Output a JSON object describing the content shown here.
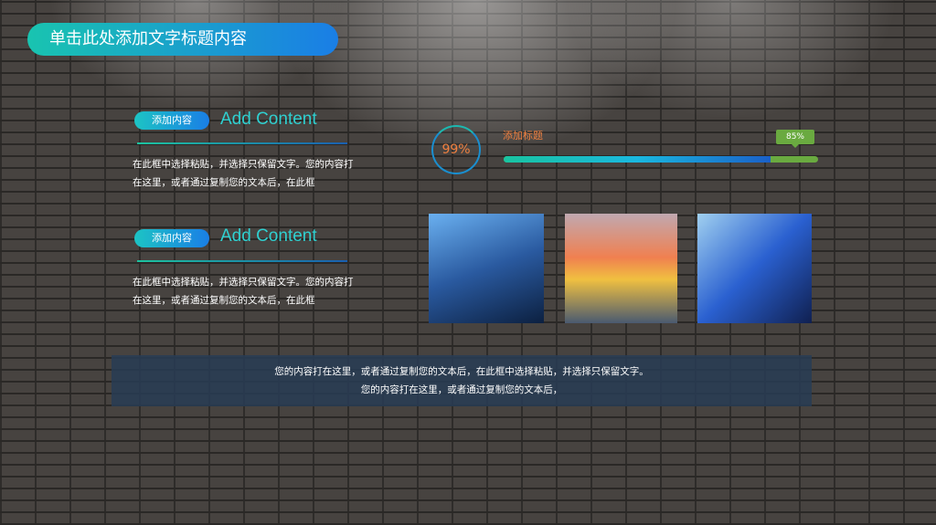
{
  "title": "单击此处添加文字标题内容",
  "sections": [
    {
      "pill": "添加内容",
      "heading": "Add Content",
      "text": "在此框中选择粘贴，并选择只保留文字。您的内容打在这里，或者通过复制您的文本后，在此框"
    },
    {
      "pill": "添加内容",
      "heading": "Add Content",
      "text": "在此框中选择粘贴，并选择只保留文字。您的内容打在这里，或者通过复制您的文本后，在此框"
    }
  ],
  "ring_label": "99%",
  "progress": {
    "label": "添加标题",
    "value_label": "85%",
    "value": 85
  },
  "note": {
    "line1": "您的内容打在这里，或者通过复制您的文本后，在此框中选择粘贴，并选择只保留文字。",
    "line2": "您的内容打在这里，或者通过复制您的文本后，"
  }
}
